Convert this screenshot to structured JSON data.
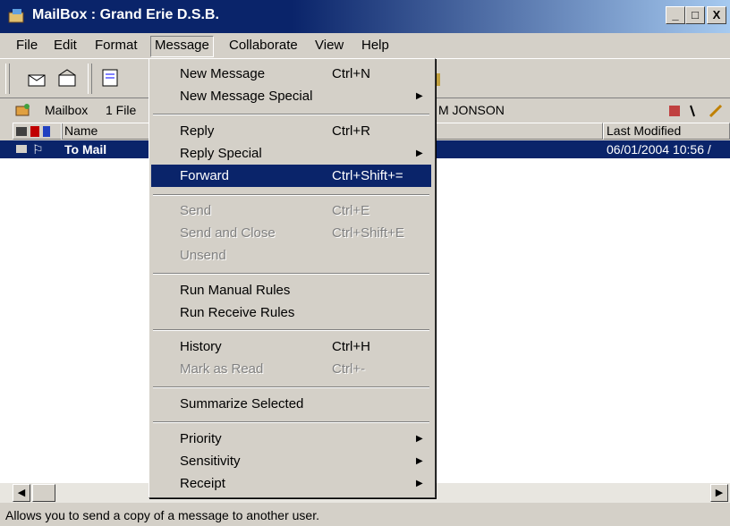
{
  "window": {
    "title": "MailBox : Grand Erie D.S.B.",
    "buttons": [
      "_",
      "□",
      "X"
    ]
  },
  "menubar": [
    "File",
    "Edit",
    "Format",
    "Message",
    "Collaborate",
    "View",
    "Help"
  ],
  "location": {
    "label": "Mailbox",
    "count": "1 File",
    "owner": "M JONSON"
  },
  "list": {
    "headers": {
      "name": "Name",
      "modified": "Last Modified"
    },
    "row": {
      "name": "To Mail",
      "modified": "06/01/2004 10:56 /"
    }
  },
  "status": "Allows you to send a copy of a message to another user.",
  "menu": {
    "new_message": {
      "label": "New Message",
      "shortcut": "Ctrl+N"
    },
    "new_message_special": {
      "label": "New Message Special"
    },
    "reply": {
      "label": "Reply",
      "shortcut": "Ctrl+R"
    },
    "reply_special": {
      "label": "Reply Special"
    },
    "forward": {
      "label": "Forward",
      "shortcut": "Ctrl+Shift+="
    },
    "send": {
      "label": "Send",
      "shortcut": "Ctrl+E"
    },
    "send_close": {
      "label": "Send and Close",
      "shortcut": "Ctrl+Shift+E"
    },
    "unsend": {
      "label": "Unsend"
    },
    "run_manual": {
      "label": "Run Manual Rules"
    },
    "run_receive": {
      "label": "Run Receive Rules"
    },
    "history": {
      "label": "History",
      "shortcut": "Ctrl+H"
    },
    "mark_read": {
      "label": "Mark as Read",
      "shortcut": "Ctrl+-"
    },
    "summarize": {
      "label": "Summarize Selected"
    },
    "priority": {
      "label": "Priority"
    },
    "sensitivity": {
      "label": "Sensitivity"
    },
    "receipt": {
      "label": "Receipt"
    }
  },
  "colors": {
    "titlebar": "#0a246a",
    "face": "#d4d0c8",
    "highlight": "#0a246a"
  }
}
